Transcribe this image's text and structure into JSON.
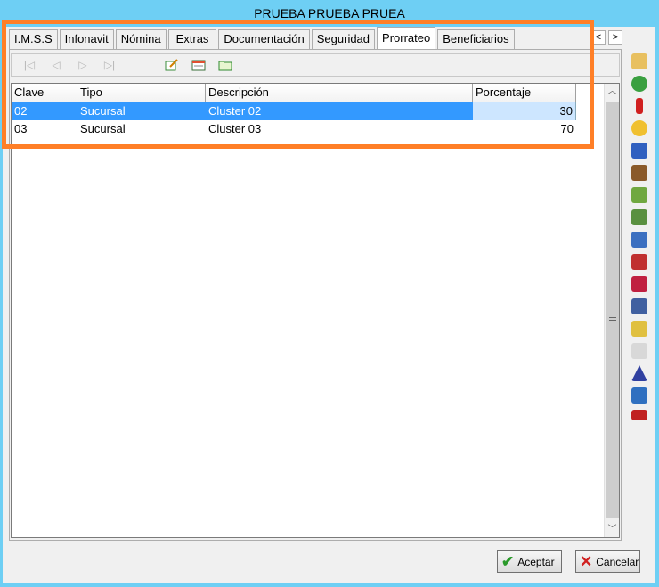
{
  "window": {
    "title": "PRUEBA PRUEBA PRUEA"
  },
  "tabs": [
    {
      "label": "I.M.S.S"
    },
    {
      "label": "Infonavit"
    },
    {
      "label": "Nómina"
    },
    {
      "label": "Extras"
    },
    {
      "label": "Documentación"
    },
    {
      "label": "Seguridad"
    },
    {
      "label": "Prorrateo"
    },
    {
      "label": "Beneficiarios"
    }
  ],
  "active_tab": "Prorrateo",
  "tab_scroll": {
    "left": "<",
    "right": ">"
  },
  "navigator": {
    "first_icon": "first-record-icon",
    "prior_icon": "prior-record-icon",
    "next_icon": "next-record-icon",
    "last_icon": "last-record-icon",
    "edit_icon": "edit-record-icon",
    "insert_icon": "insert-record-icon",
    "folder_icon": "folder-icon"
  },
  "grid": {
    "columns": [
      "Clave",
      "Tipo",
      "Descripción",
      "Porcentaje"
    ],
    "rows": [
      {
        "clave": "02",
        "tipo": "Sucursal",
        "descripcion": "Cluster 02",
        "porcentaje": "30"
      },
      {
        "clave": "03",
        "tipo": "Sucursal",
        "descripcion": "Cluster 03",
        "porcentaje": "70"
      }
    ]
  },
  "footer": {
    "accept_label": "Aceptar",
    "cancel_label": "Cancelar"
  },
  "colors": {
    "title_bar": "#6ecff4",
    "selection": "#3399ff",
    "highlight": "#ff7f27"
  }
}
